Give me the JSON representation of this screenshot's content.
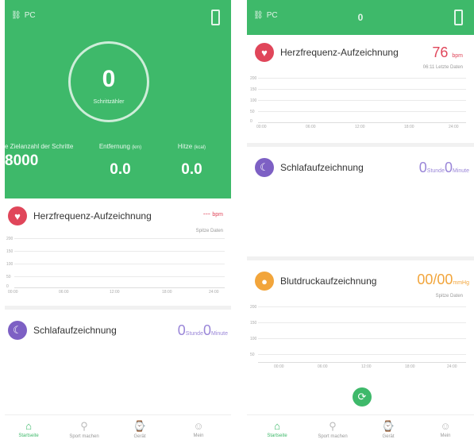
{
  "colors": {
    "brand_green": "#3eb96a",
    "heart": "#e0465a",
    "sleep": "#7d60c4",
    "blood_pressure": "#f2a53b"
  },
  "left": {
    "status": {
      "label": "PC"
    },
    "steps": {
      "value": "0",
      "sub": "Schrittzähler"
    },
    "stats": [
      {
        "label": "e Zielanzahl der Schritte",
        "value": "8000"
      },
      {
        "label": "Entfernung",
        "unit": "(km)",
        "value": "0.0"
      },
      {
        "label": "Hitze",
        "unit": "(kcal)",
        "value": "0.0"
      }
    ],
    "heart": {
      "title": "Herzfrequenz-Aufzeichnung",
      "value": "---",
      "unit": "bpm",
      "note": "Spitze Daten"
    },
    "heart_chart": {
      "yticks": [
        "200",
        "150",
        "100",
        "50",
        "0"
      ],
      "xticks": [
        "00:00",
        "06:00",
        "12:00",
        "18:00",
        "24:00"
      ]
    },
    "sleep": {
      "title": "Schlafaufzeichnung",
      "hours": "0",
      "hours_unit": "Stunde",
      "minutes": "0",
      "minutes_unit": "Minute"
    }
  },
  "right": {
    "status": {
      "label": "PC",
      "center": "0"
    },
    "heart": {
      "title": "Herzfrequenz-Aufzeichnung",
      "value": "76",
      "unit": "bpm",
      "note": "06:11 Letzte Daten"
    },
    "heart_chart": {
      "yticks": [
        "200",
        "150",
        "100",
        "50",
        "0"
      ],
      "xticks": [
        "00:00",
        "06:00",
        "12:00",
        "18:00",
        "24:00"
      ]
    },
    "sleep": {
      "title": "Schlafaufzeichnung",
      "hours": "0",
      "hours_unit": "Stunde",
      "minutes": "0",
      "minutes_unit": "Minute"
    },
    "bp": {
      "title": "Blutdruckaufzeichnung",
      "value": "00/00",
      "unit": "mmHg",
      "note": "Spitze Daten"
    },
    "bp_chart": {
      "yticks": [
        "200",
        "150",
        "100",
        "50"
      ],
      "xticks": [
        "00:00",
        "06:00",
        "12:00",
        "18:00",
        "24:00"
      ]
    }
  },
  "nav": [
    {
      "label": "Startseite",
      "icon": "home-icon",
      "glyph": "⌂",
      "active": true
    },
    {
      "label": "Sport machen",
      "icon": "run-icon",
      "glyph": "⚲",
      "active": false
    },
    {
      "label": "Gerät",
      "icon": "watch-icon",
      "glyph": "⌚",
      "active": false
    },
    {
      "label": "Mein",
      "icon": "user-icon",
      "glyph": "☺",
      "active": false
    }
  ]
}
